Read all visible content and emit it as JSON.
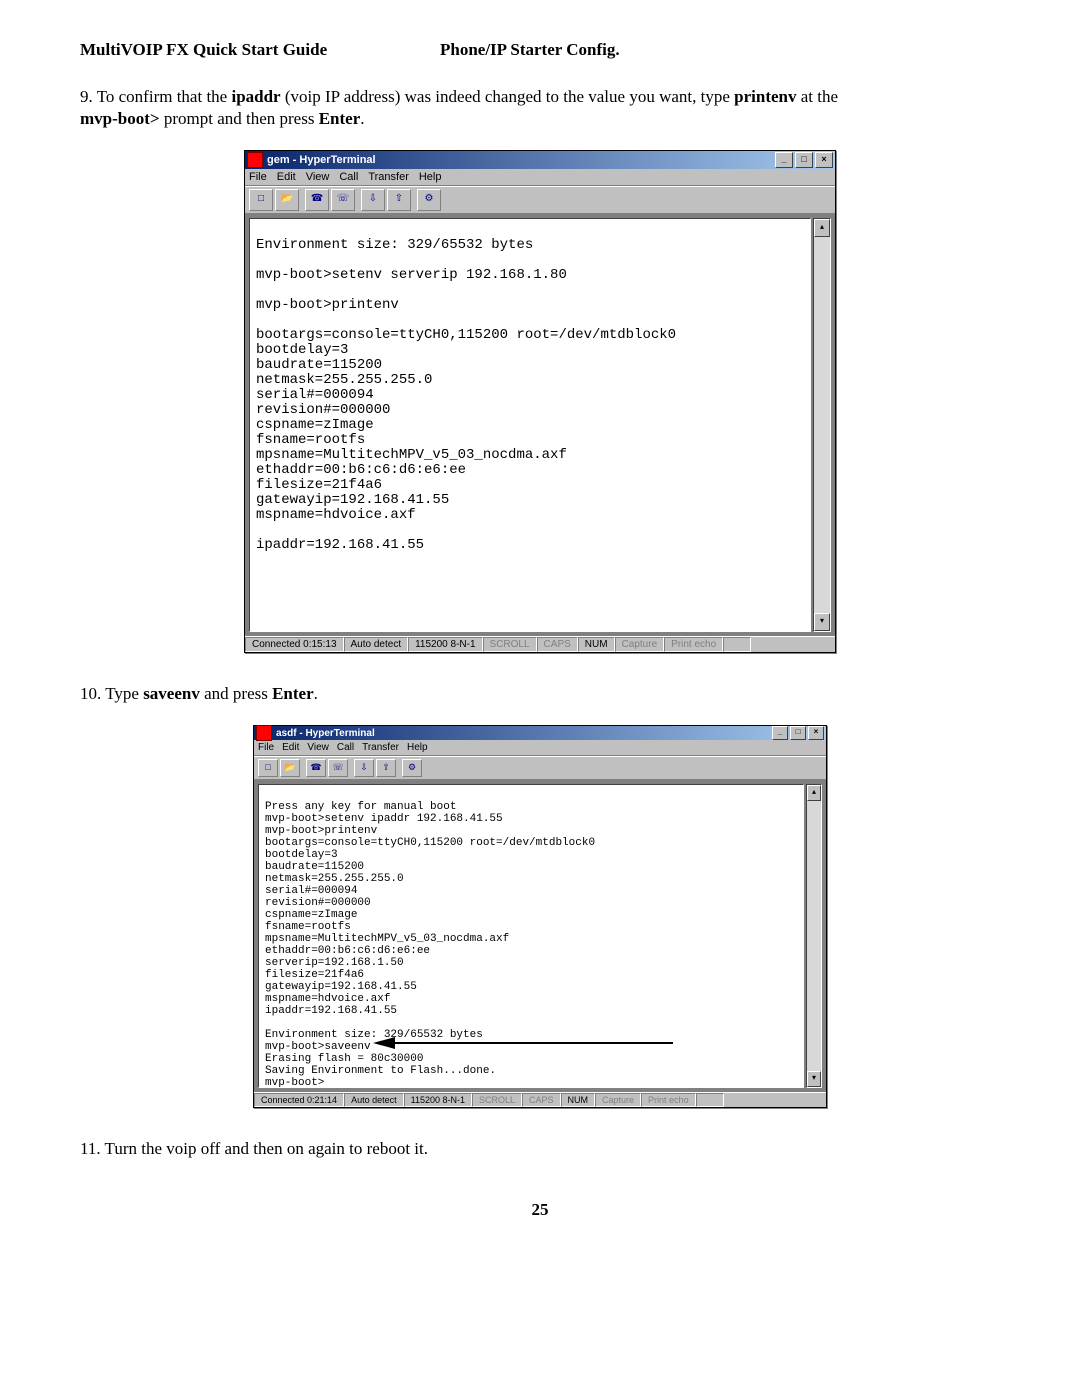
{
  "header": {
    "left": "MultiVOIP FX Quick Start Guide",
    "right": "Phone/IP Starter Config."
  },
  "steps": {
    "s9_a": "9. To confirm that the ",
    "s9_b": "ipaddr",
    "s9_c": " (voip IP address) was indeed changed to the value you want,  type  ",
    "s9_d": "printenv",
    "s9_e": "  at the ",
    "s9_f": "mvp-boot>",
    "s9_g": " prompt and then press ",
    "s9_h": "Enter",
    "s9_i": ".",
    "s10_a": "10. Type ",
    "s10_b": "saveenv",
    "s10_c": " and press ",
    "s10_d": "Enter",
    "s10_e": ".",
    "s11": "11. Turn the voip off and then on again to reboot it."
  },
  "menu": {
    "file": "File",
    "edit": "Edit",
    "view": "View",
    "call": "Call",
    "transfer": "Transfer",
    "help": "Help"
  },
  "status": {
    "scroll": "SCROLL",
    "caps": "CAPS",
    "num": "NUM",
    "capture": "Capture",
    "echo": "Print echo"
  },
  "shot1": {
    "title": "gem - HyperTerminal",
    "terminal": "\nEnvironment size: 329/65532 bytes\n\nmvp-boot>setenv serverip 192.168.1.80\n\nmvp-boot>printenv\n\nbootargs=console=ttyCH0,115200 root=/dev/mtdblock0\nbootdelay=3\nbaudrate=115200\nnetmask=255.255.255.0\nserial#=000094\nrevision#=000000\ncspname=zImage\nfsname=rootfs\nmpsname=MultitechMPV_v5_03_nocdma.axf\nethaddr=00:b6:c6:d6:e6:ee\nfilesize=21f4a6\ngatewayip=192.168.41.55\nmspname=hdvoice.axf\n\nipaddr=192.168.41.55\n\n",
    "status_conn": "Connected 0:15:13",
    "status_auto": "Auto detect",
    "status_baud": "115200 8-N-1"
  },
  "shot2": {
    "title": "asdf - HyperTerminal",
    "terminal": "\nPress any key for manual boot\nmvp-boot>setenv ipaddr 192.168.41.55\nmvp-boot>printenv\nbootargs=console=ttyCH0,115200 root=/dev/mtdblock0\nbootdelay=3\nbaudrate=115200\nnetmask=255.255.255.0\nserial#=000094\nrevision#=000000\ncspname=zImage\nfsname=rootfs\nmpsname=MultitechMPV_v5_03_nocdma.axf\nethaddr=00:b6:c6:d6:e6:ee\nserverip=192.168.1.50\nfilesize=21f4a6\ngatewayip=192.168.41.55\nmspname=hdvoice.axf\nipaddr=192.168.41.55\n\nEnvironment size: 329/65532 bytes\nmvp-boot>saveenv\nErasing flash = 80c30000\nSaving Environment to Flash...done.\nmvp-boot>",
    "status_conn": "Connected 0:21:14",
    "status_auto": "Auto detect",
    "status_baud": "115200 8-N-1"
  },
  "page_number": "25"
}
